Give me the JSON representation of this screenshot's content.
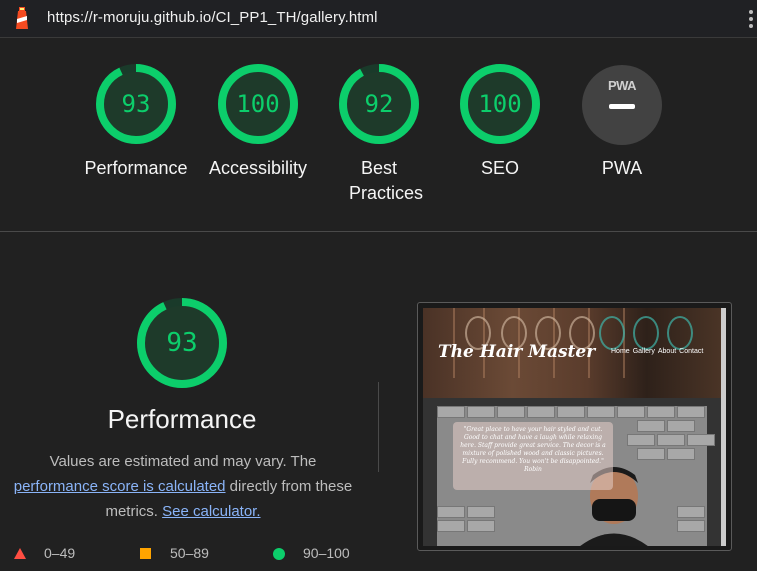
{
  "topbar": {
    "url": "https://r-moruju.github.io/CI_PP1_TH/gallery.html",
    "logo_icon": "lighthouse-icon",
    "menu_icon": "kebab-menu-icon"
  },
  "scores": [
    {
      "label": "Performance",
      "value": 93
    },
    {
      "label": "Accessibility",
      "value": 100
    },
    {
      "label": "Best Practices",
      "value": 92
    },
    {
      "label": "SEO",
      "value": 100
    }
  ],
  "pwa": {
    "badge_text": "PWA",
    "label": "PWA"
  },
  "performance": {
    "score": 93,
    "title": "Performance",
    "desc_line1": "Values are estimated and may vary. The",
    "link1": "performance score is calculated",
    "desc_mid": " directly from these",
    "desc_line3": "metrics.",
    "link2": "See calculator."
  },
  "legend": [
    {
      "range": "0–49",
      "color": "#ff4e42",
      "shape": "triangle"
    },
    {
      "range": "50–89",
      "color": "#ffa400",
      "shape": "square"
    },
    {
      "range": "90–100",
      "color": "#0cce6b",
      "shape": "circle"
    }
  ],
  "screenshot": {
    "site_title": "The Hair Master",
    "nav": [
      "Home",
      "Gallery",
      "About",
      "Contact"
    ],
    "quote": "\"Great place to have your hair styled and cut. Good to chat and have a laugh while relaxing here. Staff provide great service. The decor is a mixture of polished wood and classic pictures. Fully recommend. You won't be disappointed.\" Robin"
  },
  "colors": {
    "pass": "#0cce6b",
    "average": "#ffa400",
    "fail": "#ff4e42",
    "background": "#212121"
  }
}
